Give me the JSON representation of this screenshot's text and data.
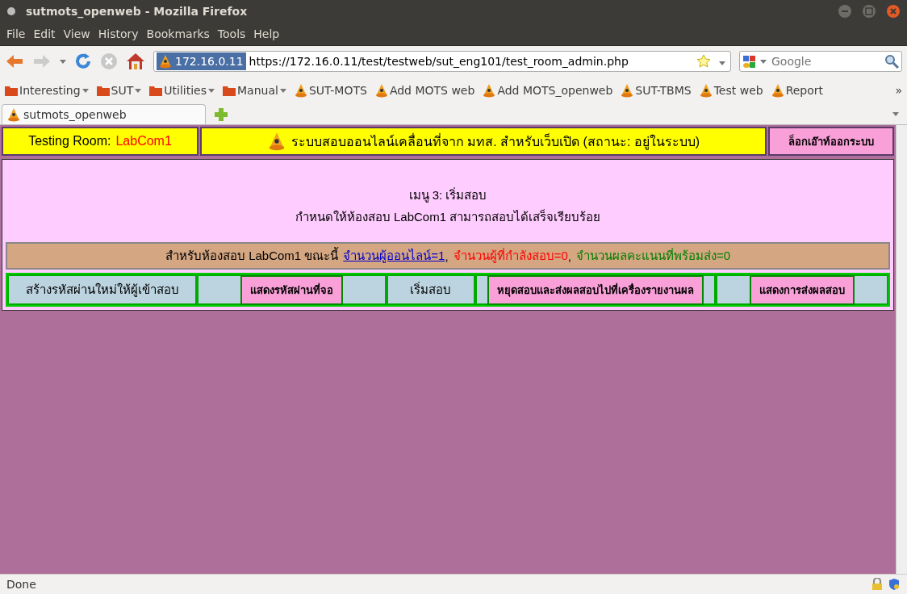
{
  "window": {
    "title": "sutmots_openweb - Mozilla Firefox"
  },
  "menu": [
    "File",
    "Edit",
    "View",
    "History",
    "Bookmarks",
    "Tools",
    "Help"
  ],
  "address": {
    "host": "172.16.0.11",
    "url": "https://172.16.0.11/test/testweb/sut_eng101/test_room_admin.php"
  },
  "search": {
    "placeholder": "Google"
  },
  "bookmarks": [
    {
      "kind": "folder",
      "label": "Interesting"
    },
    {
      "kind": "folder",
      "label": "SUT"
    },
    {
      "kind": "folder",
      "label": "Utilities"
    },
    {
      "kind": "folder",
      "label": "Manual"
    },
    {
      "kind": "site",
      "label": "SUT-MOTS"
    },
    {
      "kind": "site",
      "label": "Add MOTS web"
    },
    {
      "kind": "site",
      "label": "Add MOTS_openweb"
    },
    {
      "kind": "site",
      "label": "SUT-TBMS"
    },
    {
      "kind": "site",
      "label": "Test web"
    },
    {
      "kind": "site",
      "label": "Report"
    }
  ],
  "bookmarks_more": "»",
  "tabs": [
    {
      "label": "sutmots_openweb",
      "selected": true
    }
  ],
  "page": {
    "room_label": "Testing  Room:",
    "room_name": "LabCom1",
    "system_title": "ระบบสอบออนไลน์เคลื่อนที่จาก มทส. สำหรับเว็บเปิด (สถานะ: อยู่ในระบบ)",
    "logout": "ล็อกเอ๊าท์ออกระบบ",
    "menu_title": "เมนู 3: เริ่มสอบ",
    "message": "กำหนดให้ห้องสอบ LabCom1 สามารถสอบได้เสร็จเรียบร้อย",
    "stats_prefix": "สำหรับห้องสอบ LabCom1 ขณะนี้",
    "stats": [
      {
        "kind": "link",
        "label": "จำนวนผู้ออนไลน์=1",
        "color": "#0000cc",
        "suffix": ","
      },
      {
        "kind": "plain",
        "label": "จำนวนผู้ที่กำลังสอบ=0",
        "color": "#ff0000",
        "suffix": ","
      },
      {
        "kind": "plain",
        "label": "จำนวนผลคะแนนที่พร้อมส่ง=0",
        "color": "#008000"
      }
    ],
    "actions": [
      {
        "kind": "text",
        "label": "สร้างรหัสผ่านใหม่ให้ผู้เข้าสอบ"
      },
      {
        "kind": "button",
        "label": "แสดงรหัสผ่านที่จอ"
      },
      {
        "kind": "text",
        "label": "เริ่มสอบ"
      },
      {
        "kind": "button",
        "label": "หยุดสอบและส่งผลสอบไปที่เครื่องรายงานผล"
      },
      {
        "kind": "button",
        "label": "แสดงการส่งผลสอบ"
      }
    ]
  },
  "status_bar": {
    "text": "Done"
  }
}
